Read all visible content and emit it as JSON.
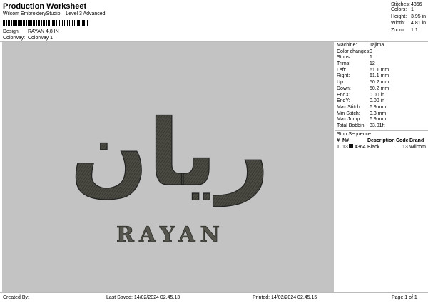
{
  "header": {
    "title": "Production Worksheet",
    "subtitle": "Wilcom EmbroideryStudio – Level 3 Advanced",
    "design_label": "Design:",
    "design_value": "RAYAN 4,8 IN",
    "colorway_label": "Colorway:",
    "colorway_value": "Colorway 1"
  },
  "stats": [
    {
      "label": "Stitches:",
      "value": "4366"
    },
    {
      "label": "Colors:",
      "value": "1"
    },
    {
      "label": "Height:",
      "value": "3.95 in"
    },
    {
      "label": "Width:",
      "value": "4.81 in"
    },
    {
      "label": "Zoom:",
      "value": "1:1"
    }
  ],
  "machine_info": [
    {
      "label": "Machine:",
      "value": "Tajima"
    },
    {
      "label": "Color changes:",
      "value": "0"
    },
    {
      "label": "Stops:",
      "value": "1"
    },
    {
      "label": "Trims:",
      "value": "12"
    },
    {
      "label": "Left:",
      "value": "61.1 mm"
    },
    {
      "label": "Right:",
      "value": "61.1 mm"
    },
    {
      "label": "Up:",
      "value": "50.2 mm"
    },
    {
      "label": "Down:",
      "value": "50.2 mm"
    },
    {
      "label": "EndX:",
      "value": "0.00 in"
    },
    {
      "label": "EndY:",
      "value": "0.00 in"
    },
    {
      "label": "Max Stitch:",
      "value": "6.9 mm"
    },
    {
      "label": "Min Stitch:",
      "value": "0.3 mm"
    },
    {
      "label": "Max Jump:",
      "value": "6.9 mm"
    },
    {
      "label": "Total Bobbin:",
      "value": "33.01ft"
    }
  ],
  "stop_sequence": {
    "heading": "Stop Sequence:",
    "columns": [
      "#",
      "N#",
      "Description",
      "Code",
      "Brand"
    ],
    "rows": [
      {
        "index": "1.",
        "n": "13",
        "stitches": "4364",
        "description": "Black",
        "code": "13",
        "brand": "Wilcom",
        "color": "#111111"
      }
    ]
  },
  "design": {
    "arabic_text": "ريان",
    "latin_text": "RAYAN",
    "thread_color": "#4a4a42",
    "background_color": "#c3c3c3"
  },
  "footer": {
    "created_by": "Created By:",
    "last_saved": "Last Saved: 14/02/2024 02.45.13",
    "printed": "Printed: 14/02/2024 02.45.15",
    "page": "Page 1 of 1"
  }
}
